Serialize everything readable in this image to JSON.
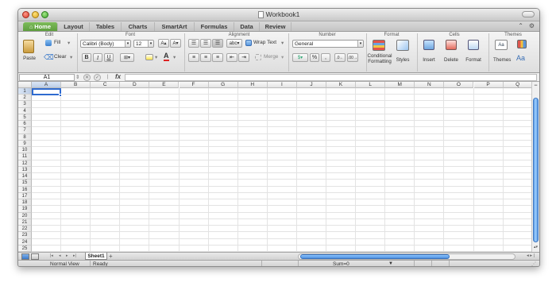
{
  "window": {
    "title": "Workbook1"
  },
  "tabs": [
    "Home",
    "Layout",
    "Tables",
    "Charts",
    "SmartArt",
    "Formulas",
    "Data",
    "Review"
  ],
  "ribbon": {
    "groups": {
      "edit": "Edit",
      "font": "Font",
      "alignment": "Alignment",
      "number": "Number",
      "format": "Format",
      "cells": "Cells",
      "themes": "Themes"
    },
    "paste": "Paste",
    "fill": "Fill",
    "clear": "Clear",
    "font_name": "Calibri (Body)",
    "font_size": "12",
    "bold": "B",
    "italic": "I",
    "underline": "U",
    "wrap_text": "Wrap Text",
    "abc": "abc",
    "merge": "Merge",
    "number_format": "General",
    "percent": "%",
    "comma": ",",
    "conditional_formatting_1": "Conditional",
    "conditional_formatting_2": "Formatting",
    "styles": "Styles",
    "insert": "Insert",
    "delete": "Delete",
    "format": "Format",
    "themes": "Themes",
    "aa": "Aa"
  },
  "formula_bar": {
    "name_box": "A1",
    "fx": "fx",
    "value": ""
  },
  "grid": {
    "columns": [
      "A",
      "B",
      "C",
      "D",
      "E",
      "F",
      "G",
      "H",
      "I",
      "J",
      "K",
      "L",
      "M",
      "N",
      "O",
      "P",
      "Q"
    ],
    "rows": [
      "1",
      "2",
      "3",
      "4",
      "5",
      "6",
      "7",
      "8",
      "9",
      "10",
      "11",
      "12",
      "13",
      "14",
      "15",
      "16",
      "17",
      "18",
      "19",
      "20",
      "21",
      "22",
      "23",
      "24",
      "25"
    ],
    "active_cell": "A1"
  },
  "sheets": {
    "active": "Sheet1",
    "add": "+"
  },
  "status": {
    "view": "Normal View",
    "state": "Ready",
    "sum": "Sum=0"
  },
  "colors": {
    "accent": "#2f6bd0",
    "active_tab": "#6aad47"
  }
}
